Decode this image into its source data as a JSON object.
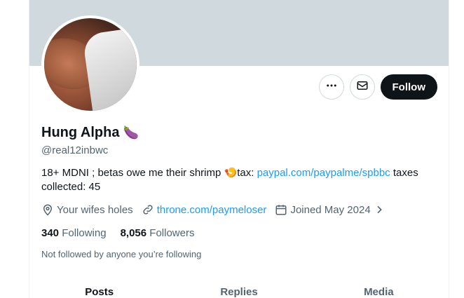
{
  "profile": {
    "display_name": "Hung Alpha",
    "name_emoji": "🍆",
    "handle": "@real12inbwc",
    "bio_text_1": "18+ MDNI ; betas owe me their shrimp ",
    "bio_emoji": "🍤",
    "bio_text_2": "tax: ",
    "bio_link": "paypal.com/paypalme/spbbc",
    "bio_text_3": " taxes collected: 45",
    "location": "Your wifes holes",
    "website": "throne.com/paymeloser",
    "joined": "Joined May 2024"
  },
  "actions": {
    "more_icon": "more-icon",
    "message_icon": "mail-icon",
    "follow_label": "Follow"
  },
  "stats": {
    "following_count": "340",
    "following_label": "Following",
    "followers_count": "8,056",
    "followers_label": "Followers"
  },
  "followed_note": "Not followed by anyone you’re following",
  "tabs": [
    {
      "label": "Posts",
      "active": true
    },
    {
      "label": "Replies",
      "active": false
    },
    {
      "label": "Media",
      "active": false
    }
  ],
  "colors": {
    "banner": "#cfd9de",
    "link": "#1d9bf0",
    "follow_bg": "#0f1419"
  }
}
